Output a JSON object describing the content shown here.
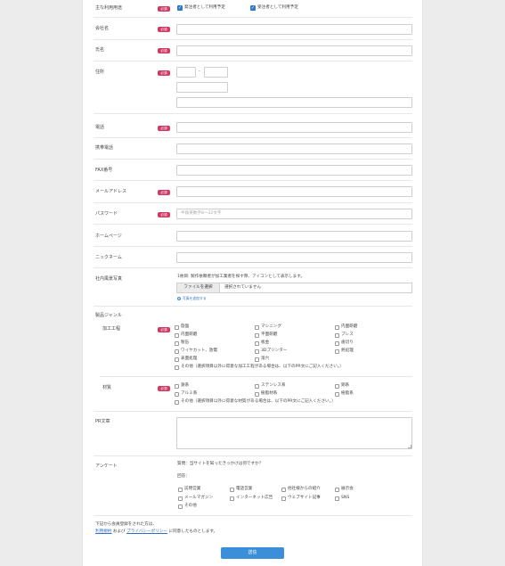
{
  "required_badge": "必須",
  "usage": {
    "label": "主な利用用途",
    "options": [
      {
        "label": "発注者として利用予定",
        "checked": true
      },
      {
        "label": "受注者として利用予定",
        "checked": true
      }
    ]
  },
  "fields": {
    "company": "会社名",
    "name": "氏名",
    "address": "住所",
    "zip_sep": "-",
    "phone": "電話",
    "mobile": "携帯電話",
    "fax": "FAX番号",
    "email": "メールアドレス",
    "password": "パスワード",
    "password_placeholder": "半角英数字8〜32文字",
    "homepage": "ホームページ",
    "nickname": "ニックネーム"
  },
  "photo": {
    "label": "社内風景写真",
    "note": "1枚目: 製作依頼者が加工業者を探す際、アイコンとして表示します。",
    "file_button": "ファイルを選択",
    "file_status": "選択されていません",
    "add_link": "写真を追加する"
  },
  "product_genre": {
    "label": "製品ジャンル",
    "process": {
      "label": "加工工程",
      "options": [
        "旋盤",
        "マシニング",
        "内面研磨",
        "内面研磨",
        "平面研磨",
        "プレス",
        "製缶",
        "板金",
        "歯切り",
        "ワイヤカット、放電",
        "3Dプリンター",
        "熱処理",
        "表面処理",
        "溶穴"
      ],
      "other": "その他（選択項目以外に得意な加工工程がある場合は、以下のPR文にご記入ください。）"
    },
    "material": {
      "label": "材質",
      "options": [
        "鉄系",
        "ステンレス系",
        "銅系",
        "アルミ系",
        "樹脂材系",
        "樹脂系"
      ],
      "other": "その他（選択項目以外に得意な材質がある場合は、以下のPR文にご記入ください。）"
    }
  },
  "pr": {
    "label": "PR文章"
  },
  "survey": {
    "label": "アンケート",
    "question": "質問：当サイトを知ったきっかけは何ですか？",
    "answer_label": "回答：",
    "options": [
      "訪問営業",
      "電話営業",
      "他社様からの紹介",
      "展示会",
      "メールマガジン",
      "インターネット広告",
      "ウェブサイト記事",
      "SNS",
      "その他"
    ]
  },
  "agreement": {
    "line1": "下記から会員登録をされた方は、",
    "terms": "利用規約",
    "and": "および",
    "privacy": "プライバシーポリシー",
    "suffix": "に同意したものとします。"
  },
  "submit_label": "送信",
  "colors": {
    "accent": "#3a8fd8",
    "required": "#d33a63",
    "link": "#2f6fc9"
  }
}
